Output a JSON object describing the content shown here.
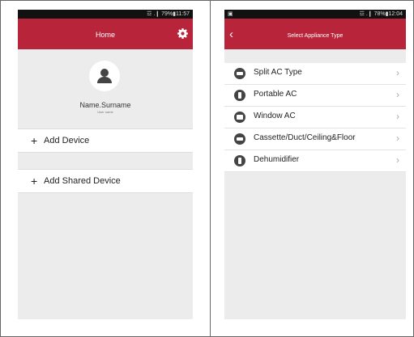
{
  "left": {
    "status": {
      "text": "☲ .❙ 79%▮11:57"
    },
    "appbar": {
      "title": "Home"
    },
    "profile": {
      "name": "Name.Surname",
      "subtitle": "User name"
    },
    "actions": [
      {
        "label": "Add Device"
      },
      {
        "label": "Add Shared Device"
      }
    ]
  },
  "right": {
    "status": {
      "left": "▣",
      "text": "☲ .❙ 78%▮12:04"
    },
    "appbar": {
      "title": "Select Appliance Type",
      "back_icon": "chevron-left-icon"
    },
    "items": [
      {
        "label": "Split AC Type"
      },
      {
        "label": "Portable AC"
      },
      {
        "label": "Window AC"
      },
      {
        "label": "Cassette/Duct/Ceiling&Floor"
      },
      {
        "label": "Dehumidifier"
      }
    ]
  },
  "colors": {
    "accent": "#b8253a",
    "background": "#ececec",
    "status_bar": "#111111"
  },
  "icons": [
    "gear-icon",
    "user-avatar-icon",
    "plus-icon",
    "chevron-left-icon",
    "chevron-right-icon",
    "appliance-icon"
  ]
}
